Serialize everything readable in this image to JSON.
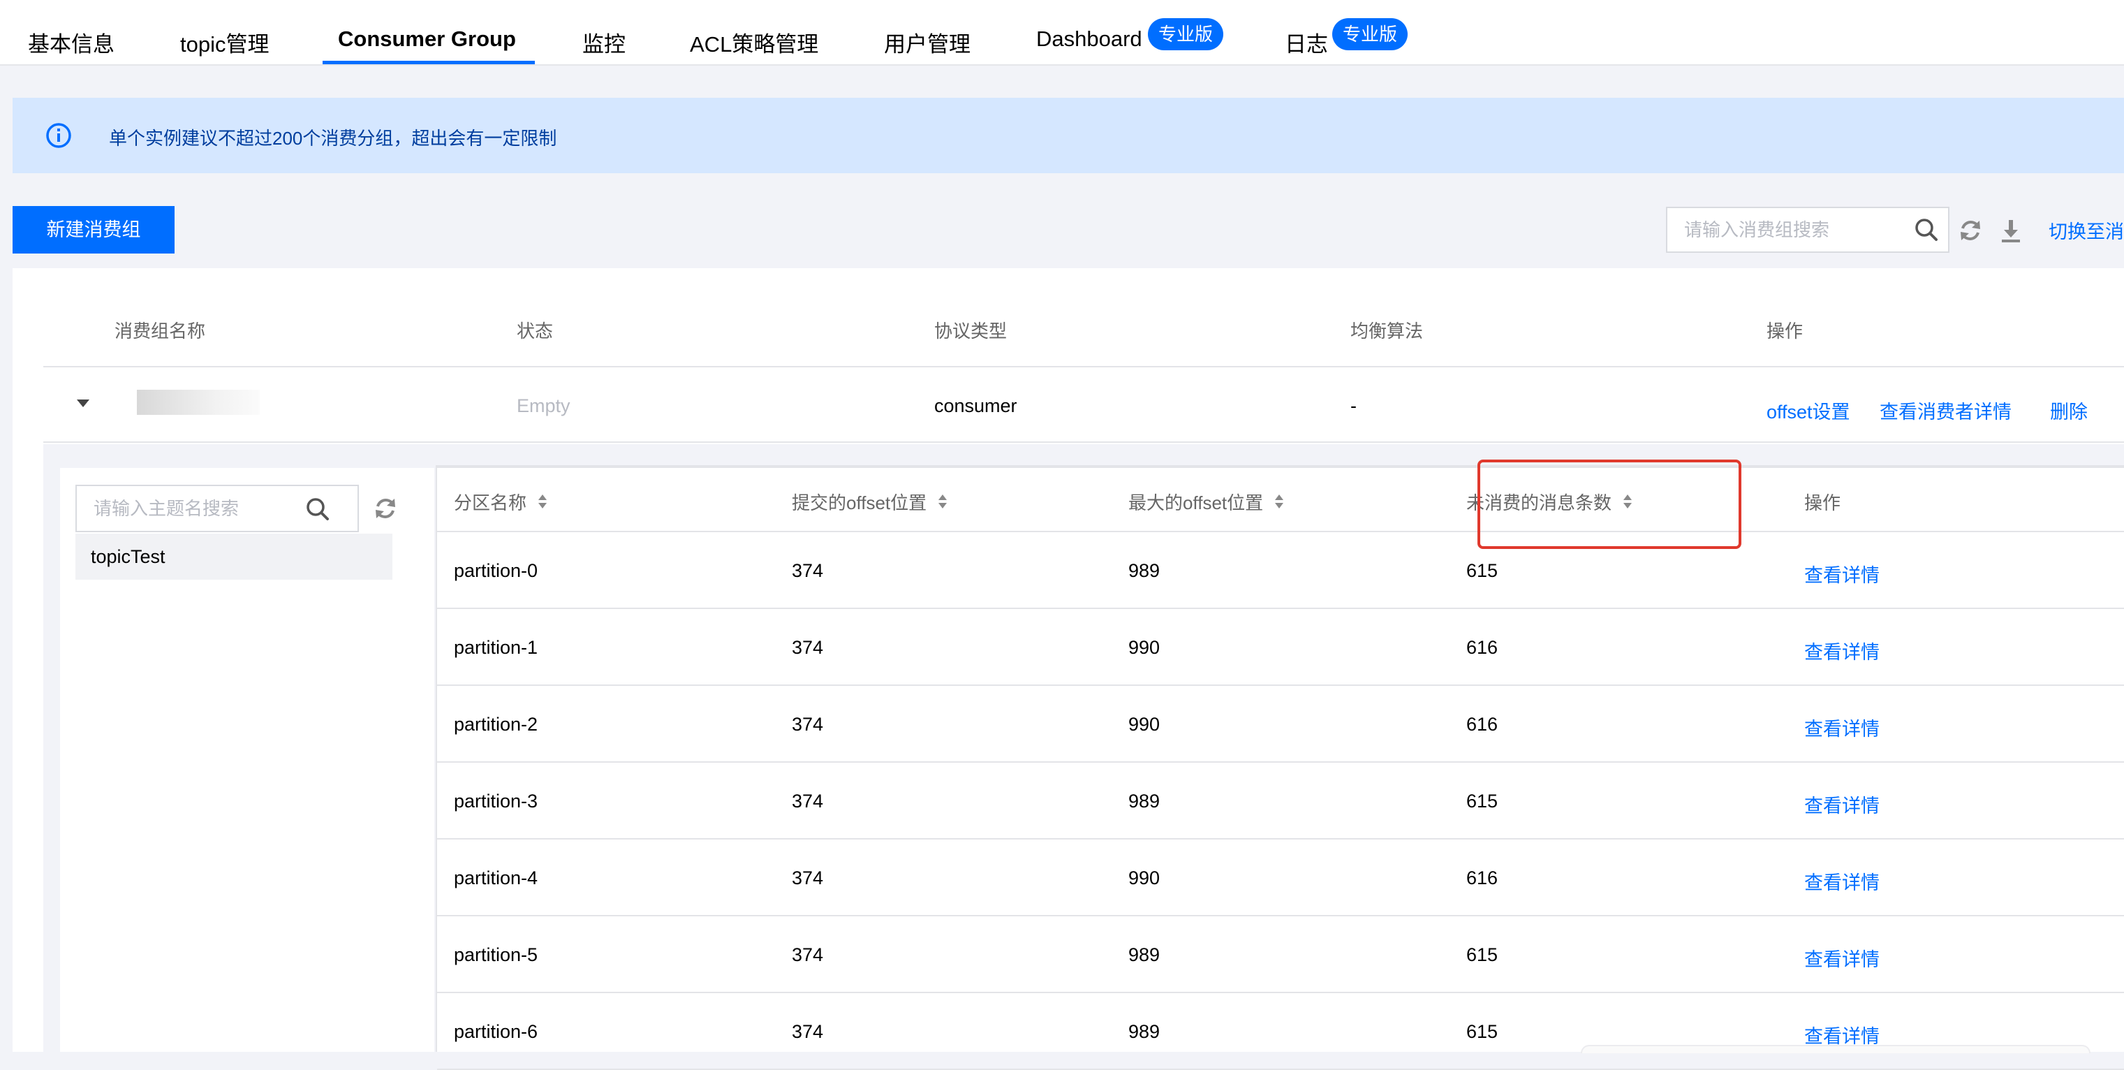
{
  "tabs": [
    {
      "label": "基本信息"
    },
    {
      "label": "topic管理"
    },
    {
      "label": "Consumer Group"
    },
    {
      "label": "监控"
    },
    {
      "label": "ACL策略管理"
    },
    {
      "label": "用户管理"
    },
    {
      "label": "Dashboard",
      "badge": "专业版"
    },
    {
      "label": "日志",
      "badge": "专业版"
    }
  ],
  "active_tab": "Consumer Group",
  "notice": {
    "text": "单个实例建议不超过200个消费分组，超出会有一定限制",
    "icon": "info-circle-icon"
  },
  "toolbar": {
    "create_label": "新建消费组",
    "search_placeholder": "请输入消费组搜索",
    "switch_label": "切换至消"
  },
  "group_table": {
    "columns": [
      "消费组名称",
      "状态",
      "协议类型",
      "均衡算法",
      "操作"
    ],
    "row": {
      "status": "Empty",
      "protocol": "consumer",
      "algorithm": "-",
      "actions": [
        "offset设置",
        "查看消费者详情",
        "删除"
      ]
    }
  },
  "topic_panel": {
    "search_placeholder": "请输入主题名搜索",
    "topics": [
      "topicTest"
    ]
  },
  "partition_table": {
    "columns": [
      "分区名称",
      "提交的offset位置",
      "最大的offset位置",
      "未消费的消息条数",
      "操作"
    ],
    "highlighted_column": "未消费的消息条数",
    "rows": [
      {
        "name": "partition-0",
        "committed": "374",
        "max": "989",
        "unconsumed": "615",
        "action": "查看详情"
      },
      {
        "name": "partition-1",
        "committed": "374",
        "max": "990",
        "unconsumed": "616",
        "action": "查看详情"
      },
      {
        "name": "partition-2",
        "committed": "374",
        "max": "990",
        "unconsumed": "616",
        "action": "查看详情"
      },
      {
        "name": "partition-3",
        "committed": "374",
        "max": "989",
        "unconsumed": "615",
        "action": "查看详情"
      },
      {
        "name": "partition-4",
        "committed": "374",
        "max": "990",
        "unconsumed": "616",
        "action": "查看详情"
      },
      {
        "name": "partition-5",
        "committed": "374",
        "max": "989",
        "unconsumed": "615",
        "action": "查看详情"
      },
      {
        "name": "partition-6",
        "committed": "374",
        "max": "989",
        "unconsumed": "615",
        "action": "查看详情"
      }
    ]
  },
  "colors": {
    "primary": "#006eff",
    "notice_bg": "#d5e7ff",
    "highlight": "#e0392d"
  }
}
